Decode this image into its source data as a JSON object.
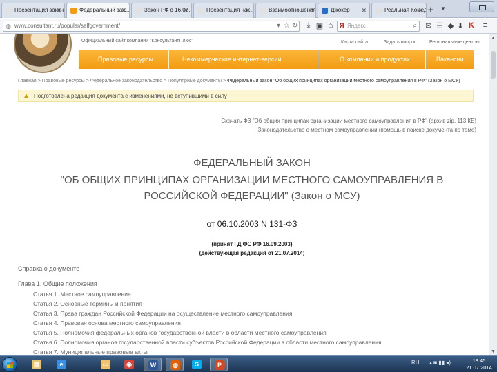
{
  "tabs": [
    {
      "label": "Презентация закона",
      "favicon_color": "#e1e1e1",
      "active": false
    },
    {
      "label": "Федеральный зак...",
      "favicon_color": "#f39c12",
      "active": true
    },
    {
      "label": "Закон РФ о 16.07...",
      "favicon_color": "#e1e1e1",
      "active": false
    },
    {
      "label": "Презентация на ...",
      "favicon_color": "#e1e1e1",
      "active": false
    },
    {
      "label": "Взаимоотношения орг...",
      "favicon_color": "#e1e1e1",
      "active": false
    },
    {
      "label": "Джокер",
      "favicon_color": "#2d6cc0",
      "active": false
    },
    {
      "label": "Реальная Комеди...",
      "favicon_color": "#e1e1e1",
      "active": false
    }
  ],
  "url": "www.consultant.ru/popular/selfgovernment/",
  "search_placeholder": "Яндекс",
  "site": {
    "official": "Официальный сайт компании \"КонсультантПлюс\"",
    "toplinks": [
      "Карта сайта",
      "Задать вопрос",
      "Региональные центры"
    ],
    "menu": [
      "Правовые ресурсы",
      "Некоммерческие интернет-версии",
      "О компании и продуктах",
      "Вакансии"
    ]
  },
  "breadcrumbs_prefix": "Главная > Правовые ресурсы > Федеральное законодательство > Популярные документы > ",
  "breadcrumbs_current": "Федеральный закон \"Об общих принципах организации местного самоуправления в РФ\" (Закон о МСУ)",
  "warning": "Подготовлена редакция документа с изменениями, не вступившими в силу",
  "download_link": "Скачать ФЗ \"Об общих принципах организации местного самоуправления в РФ\" (архив zip, 113 КБ)",
  "related_link": "Законодательство о местном самоуправлении (помощь в поиске документа по теме)",
  "doc": {
    "title1": "ФЕДЕРАЛЬНЫЙ ЗАКОН",
    "title2": "\"ОБ ОБЩИХ ПРИНЦИПАХ ОРГАНИЗАЦИИ МЕСТНОГО САМОУПРАВЛЕНИЯ В",
    "title3": "РОССИЙСКОЙ ФЕДЕРАЦИИ\" (Закон о МСУ)",
    "date": "от 06.10.2003 N 131-ФЗ",
    "adopted": "(принят ГД ФС РФ 16.09.2003)",
    "edition": "(действующая редакция от 21.07.2014)"
  },
  "about_link": "Справка о документе",
  "chapter": "Глава 1. Общие положения",
  "articles": [
    "Статья 1. Местное самоуправление",
    "Статья 2. Основные термины и понятия",
    "Статья 3. Права граждан Российской Федерации на осуществление местного самоуправления",
    "Статья 4. Правовая основа местного самоуправления",
    "Статья 5. Полномочия федеральных органов государственной власти в области местного самоуправления",
    "Статья 6. Полномочия органов государственной власти субъектов Российской Федерации в области местного самоуправления",
    "Статья 7. Муниципальные правовые акты"
  ],
  "taskbar": {
    "apps": [
      {
        "name": "explorer",
        "glyph": "▤",
        "color": "#e9c46a",
        "active": false
      },
      {
        "name": "ie",
        "glyph": "e",
        "color": "#3a8ee6",
        "active": false
      },
      {
        "name": "folder",
        "glyph": "▭",
        "color": "#f0c36a",
        "active": false
      },
      {
        "name": "chrome",
        "glyph": "◉",
        "color": "#db4437",
        "active": false
      },
      {
        "name": "word",
        "glyph": "W",
        "color": "#2b579a",
        "active": true
      },
      {
        "name": "firefox",
        "glyph": "◍",
        "color": "#e66000",
        "active": true
      },
      {
        "name": "skype",
        "glyph": "S",
        "color": "#00aff0",
        "active": false
      },
      {
        "name": "powerpoint",
        "glyph": "P",
        "color": "#d24726",
        "active": true
      }
    ],
    "lang": "RU",
    "time": "18:45",
    "date": "21.07.2014"
  }
}
